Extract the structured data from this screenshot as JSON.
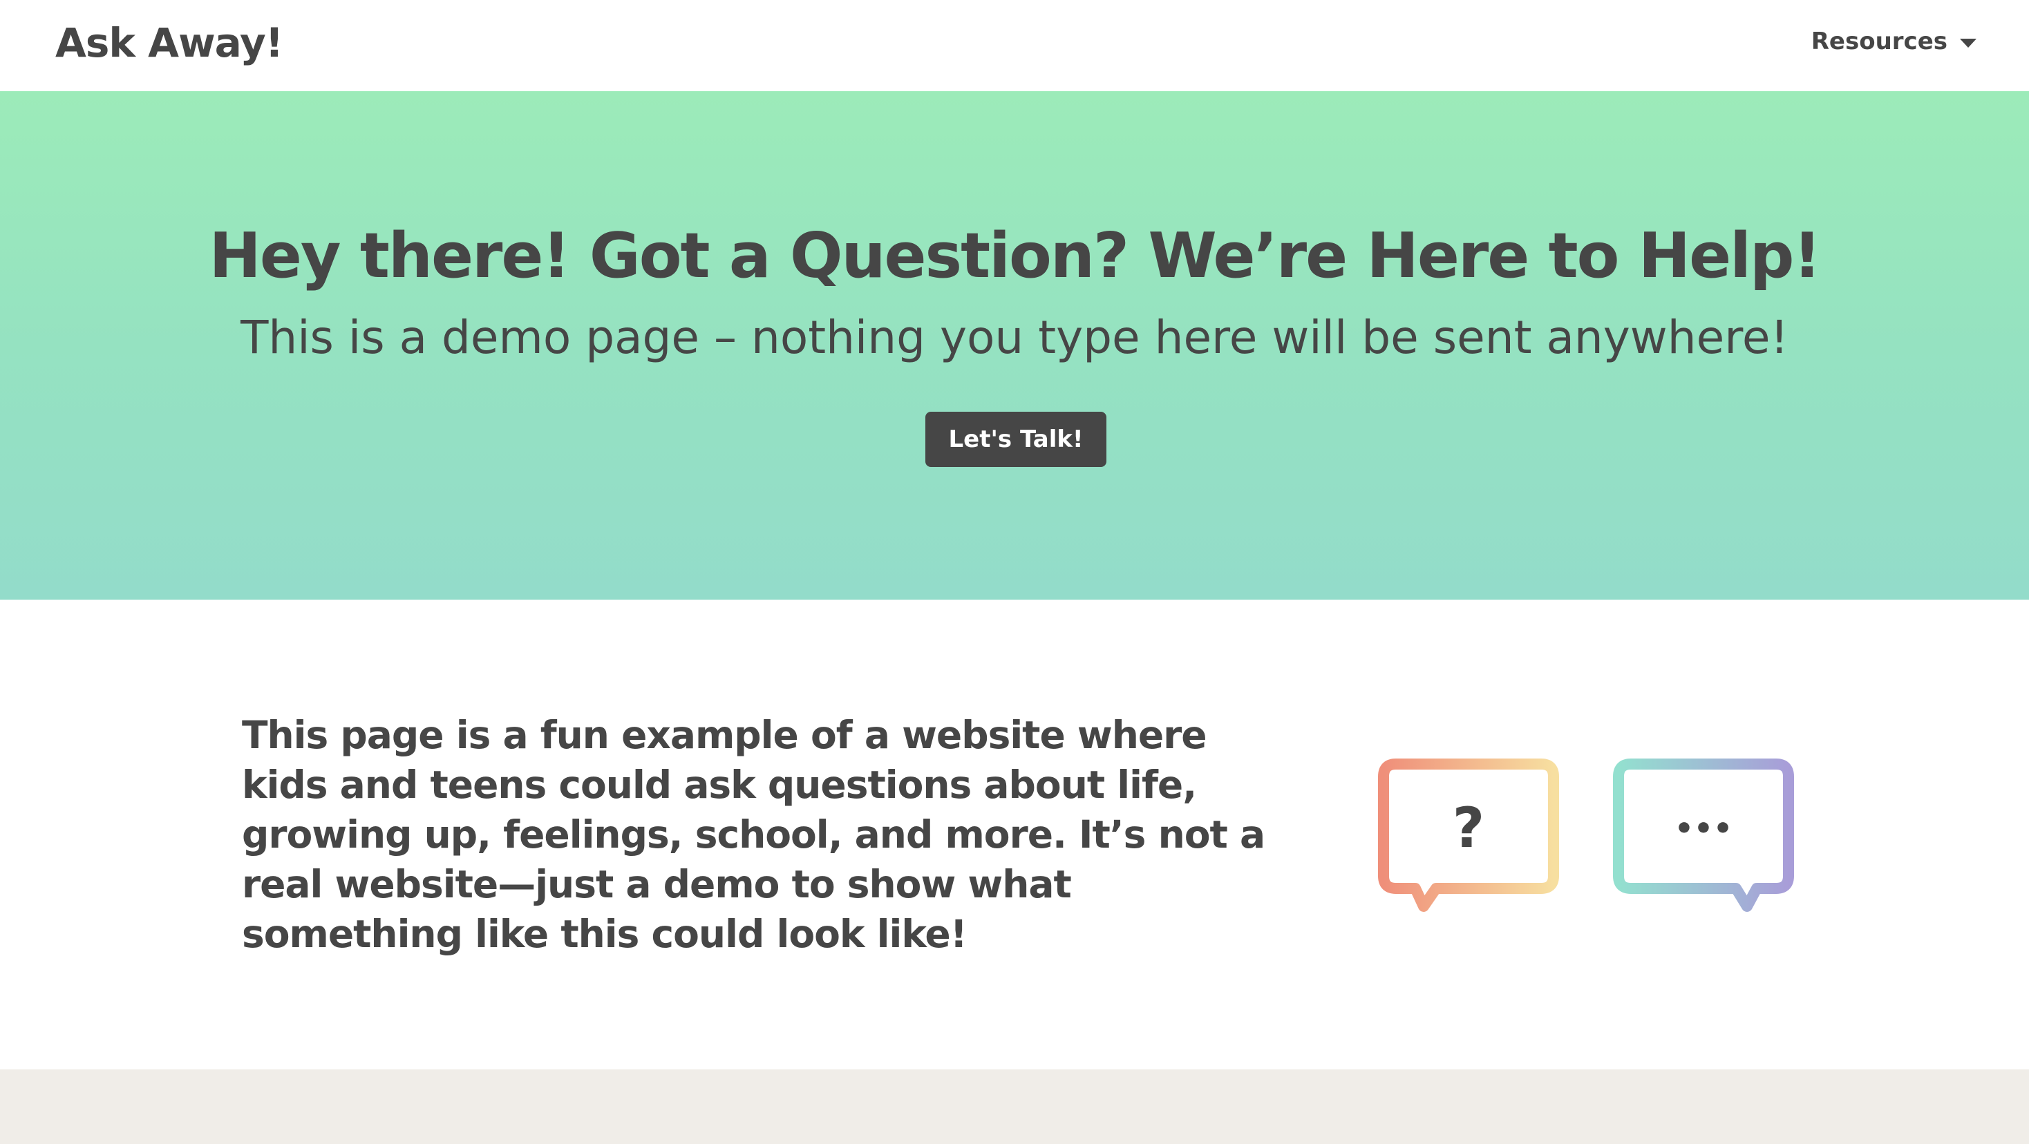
{
  "navbar": {
    "brand": "Ask Away!",
    "resources_label": "Resources"
  },
  "hero": {
    "title": "Hey there! Got a Question? We’re Here to Help!",
    "subtitle": "This is a demo page – nothing you type here will be sent anywhere!",
    "cta_label": "Let's Talk!"
  },
  "intro": {
    "text": "This page is a fun example of a website where kids and teens could ask questions about life, growing up, feelings, school, and more. It’s not a real website—just a demo to show what something like this could look like!",
    "bubble_question_glyph": "?",
    "bubble_dots_glyph": "•••"
  },
  "colors": {
    "text": "#464646",
    "hero_gradient_top": "#9cebb9",
    "hero_gradient_bottom": "#93dcca",
    "button_bg": "#464646",
    "footer_bg": "#f0ede8",
    "bubble_warm_start": "#ef8f7a",
    "bubble_warm_end": "#f7dfa0",
    "bubble_cool_start": "#93e0cf",
    "bubble_cool_end": "#a89dd8"
  },
  "icons": {
    "dropdown": "chevron-down-icon",
    "bubble_question": "question-bubble-icon",
    "bubble_dots": "ellipsis-bubble-icon"
  }
}
